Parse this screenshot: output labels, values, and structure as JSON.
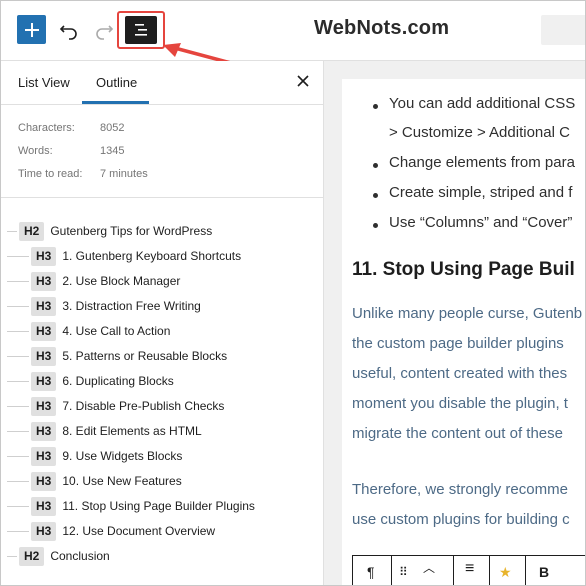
{
  "brand": "WebNots.com",
  "toolbar": {
    "add_icon": "plus-icon",
    "undo_icon": "undo-icon",
    "redo_icon": "redo-icon",
    "document_overview_icon": "document-overview-icon",
    "accent": "#2271b1",
    "highlight": "#e5453e"
  },
  "sidebar": {
    "tabs": [
      {
        "label": "List View",
        "active": false
      },
      {
        "label": "Outline",
        "active": true
      }
    ],
    "stats": [
      {
        "label": "Characters:",
        "value": "8052"
      },
      {
        "label": "Words:",
        "value": "1345"
      },
      {
        "label": "Time to read:",
        "value": "7 minutes"
      }
    ],
    "outline": [
      {
        "level": "H2",
        "text": "Gutenberg Tips for WordPress"
      },
      {
        "level": "H3",
        "text": "1. Gutenberg Keyboard Shortcuts"
      },
      {
        "level": "H3",
        "text": "2. Use Block Manager"
      },
      {
        "level": "H3",
        "text": "3. Distraction Free Writing"
      },
      {
        "level": "H3",
        "text": "4. Use Call to Action"
      },
      {
        "level": "H3",
        "text": "5. Patterns or Reusable Blocks"
      },
      {
        "level": "H3",
        "text": "6. Duplicating Blocks"
      },
      {
        "level": "H3",
        "text": "7. Disable Pre-Publish Checks"
      },
      {
        "level": "H3",
        "text": "8. Edit Elements as HTML"
      },
      {
        "level": "H3",
        "text": "9. Use Widgets Blocks"
      },
      {
        "level": "H3",
        "text": "10. Use New Features"
      },
      {
        "level": "H3",
        "text": "11. Stop Using Page Builder Plugins"
      },
      {
        "level": "H3",
        "text": "12. Use Document Overview"
      },
      {
        "level": "H2",
        "text": "Conclusion"
      }
    ]
  },
  "content": {
    "bullets": [
      {
        "line1": "You can add additional CSS",
        "line2": "> Customize > Additional C"
      },
      {
        "line1": "Change elements from para"
      },
      {
        "line1": "Create simple, striped and f"
      },
      {
        "line1": "Use “Columns” and “Cover”"
      }
    ],
    "heading": "11. Stop Using Page Buil",
    "paragraph1": [
      "Unlike many people curse, Gutenb",
      "the custom page builder plugins",
      "useful, content created with thes",
      "moment you disable the plugin, t",
      "migrate the content out of these"
    ],
    "paragraph2": [
      "Therefore, we strongly recomme",
      "use custom plugins for building c"
    ],
    "block_toolbar_bold": "B"
  }
}
